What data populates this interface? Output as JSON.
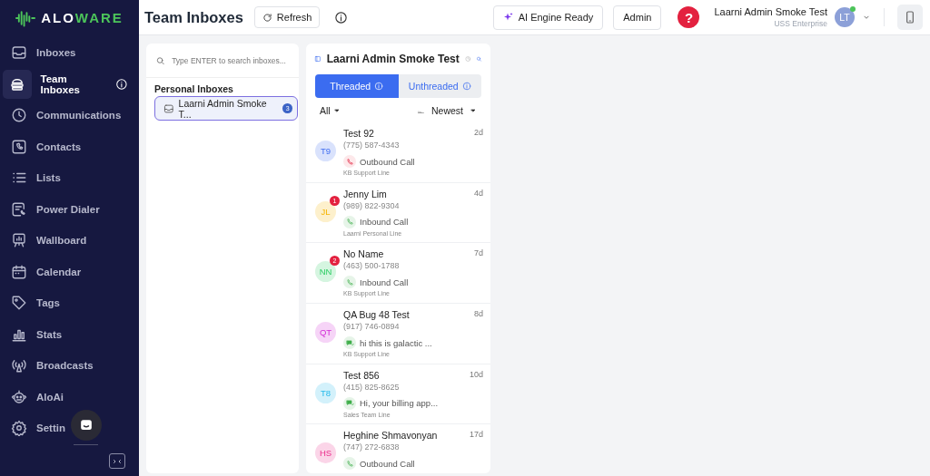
{
  "brand": {
    "first": "ALO",
    "second": "WARE"
  },
  "sidebar": {
    "items": [
      {
        "label": "Inboxes",
        "selected": false,
        "info": false
      },
      {
        "label": "Team Inboxes",
        "selected": true,
        "info": true
      },
      {
        "label": "Communications",
        "selected": false,
        "info": false
      },
      {
        "label": "Contacts",
        "selected": false,
        "info": false
      },
      {
        "label": "Lists",
        "selected": false,
        "info": false
      },
      {
        "label": "Power Dialer",
        "selected": false,
        "info": false
      },
      {
        "label": "Wallboard",
        "selected": false,
        "info": false
      },
      {
        "label": "Calendar",
        "selected": false,
        "info": false
      },
      {
        "label": "Tags",
        "selected": false,
        "info": false
      },
      {
        "label": "Stats",
        "selected": false,
        "info": false
      },
      {
        "label": "Broadcasts",
        "selected": false,
        "info": false
      },
      {
        "label": "AloAi",
        "selected": false,
        "info": false
      },
      {
        "label": "Settin",
        "selected": false,
        "info": false
      }
    ]
  },
  "header": {
    "title": "Team Inboxes",
    "refresh": "Refresh",
    "ai_status": "AI Engine Ready",
    "role": "Admin",
    "help": "?",
    "user": {
      "name": "Laarni Admin Smoke Test",
      "company": "USS Enterprise",
      "initials": "LT",
      "online": true
    }
  },
  "inboxes": {
    "search_placeholder": "Type ENTER to search inboxes...",
    "section": "Personal Inboxes",
    "items": [
      {
        "label": "Laarni Admin Smoke T...",
        "count": "3",
        "selected": true
      }
    ]
  },
  "thread_panel": {
    "title": "Laarni Admin Smoke Test",
    "tabs": [
      {
        "label": "Threaded",
        "selected": true
      },
      {
        "label": "Unthreaded",
        "selected": false
      }
    ],
    "filter": "All",
    "sort": "Newest",
    "conversations": [
      {
        "initials": "T9",
        "color": "#d9e2fc",
        "name": "Test 92",
        "phone": "(775) 587-4343",
        "kind": "call-missed",
        "preview": "Outbound Call",
        "line": "KB Support Line",
        "age": "2d"
      },
      {
        "initials": "JL",
        "color": "#fdf0cc",
        "unread": "1",
        "name": "Jenny Lim",
        "phone": "(989) 822-9304",
        "kind": "call",
        "preview": "Inbound Call",
        "line": "Laarni Personal Line",
        "age": "4d"
      },
      {
        "initials": "NN",
        "color": "#d5f5e0",
        "unread": "2",
        "name": "No Name",
        "phone": "(463) 500-1788",
        "kind": "call",
        "preview": "Inbound Call",
        "line": "KB Support Line",
        "age": "7d"
      },
      {
        "initials": "QT",
        "color": "#f6d4f7",
        "name": "QA Bug 48 Test",
        "phone": "(917) 746-0894",
        "kind": "sms",
        "preview": "hi this is galactic ...",
        "line": "KB Support Line",
        "age": "8d"
      },
      {
        "initials": "T8",
        "color": "#d3f1fb",
        "name": "Test 856",
        "phone": "(415) 825-8625",
        "kind": "sms",
        "preview": "Hi, your billing app...",
        "line": "Sales Team Line",
        "age": "10d"
      },
      {
        "initials": "HS",
        "color": "#fbd5e8",
        "name": "Heghine Shmavonyan",
        "phone": "(747) 272-6838",
        "kind": "call",
        "preview": "Outbound Call",
        "age": "17d"
      }
    ]
  }
}
